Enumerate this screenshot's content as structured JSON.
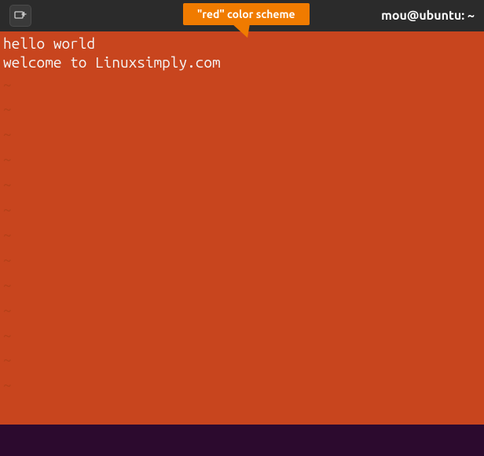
{
  "titlebar": {
    "window_title": "mou@ubuntu: ~"
  },
  "callout": {
    "text": "\"red\" color scheme"
  },
  "terminal": {
    "lines": [
      "hello world",
      "welcome to Linuxsimply.com"
    ],
    "tilde_count": 13,
    "tilde_char": "~"
  },
  "colors": {
    "terminal_bg": "#c8451e",
    "titlebar_bg": "#2b2b2b",
    "statusbar_bg": "#2c0a2e",
    "callout_bg": "#f07b00"
  }
}
